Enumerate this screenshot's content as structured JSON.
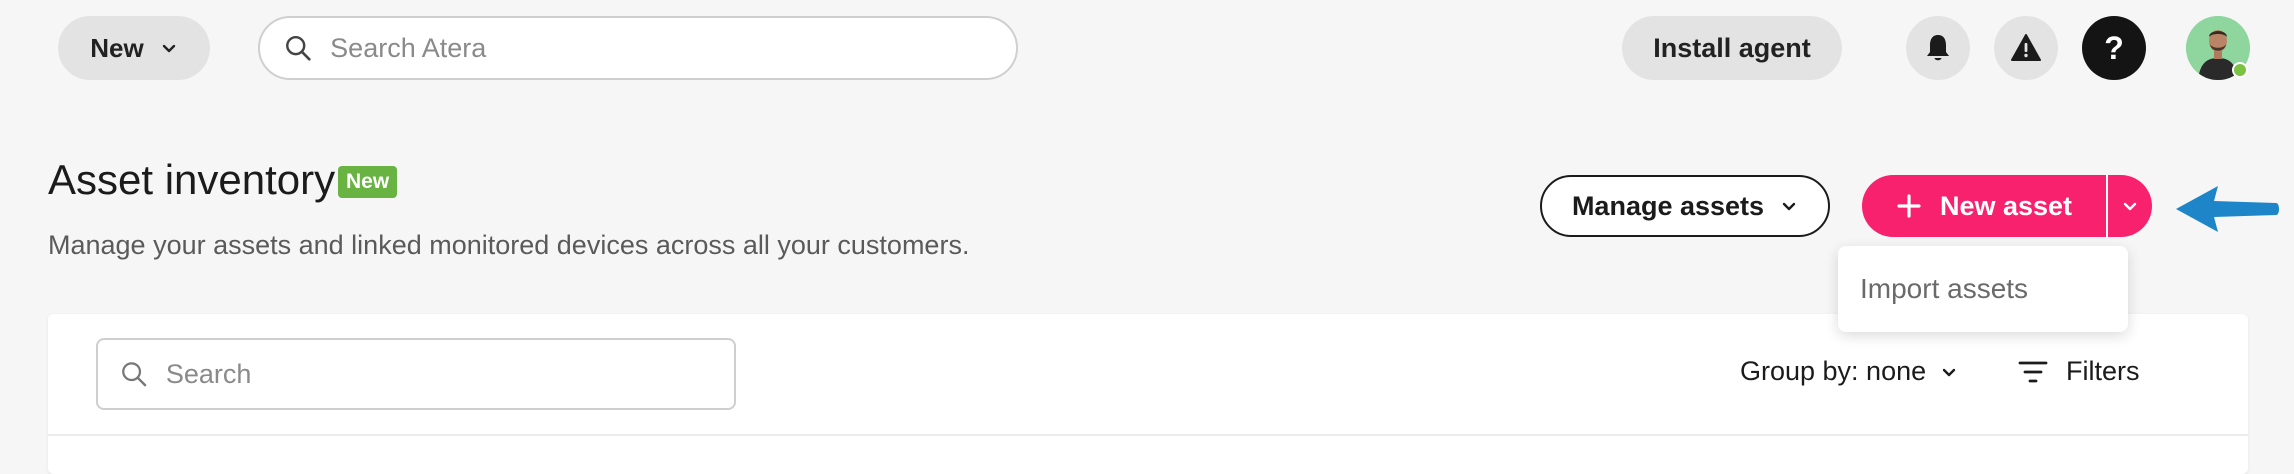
{
  "topbar": {
    "new_label": "New",
    "search_placeholder": "Search Atera",
    "install_agent_label": "Install agent",
    "help_label": "?"
  },
  "header": {
    "title": "Asset inventory",
    "badge": "New",
    "subtitle": "Manage your assets and linked monitored devices across all your customers."
  },
  "actions": {
    "manage_assets_label": "Manage assets",
    "new_asset_label": "New asset",
    "dropdown_items": [
      "Import assets"
    ]
  },
  "table": {
    "search_placeholder": "Search",
    "group_by_label": "Group by: none",
    "filters_label": "Filters"
  },
  "colors": {
    "accent": "#f7216e",
    "badge": "#69b342",
    "arrow": "#1e86c8",
    "presence": "#7cc242"
  },
  "icons": [
    "chevron-down-icon",
    "search-icon",
    "bell-icon",
    "warning-icon",
    "help-icon",
    "plus-icon",
    "filter-icon",
    "pointer-arrow-icon"
  ]
}
